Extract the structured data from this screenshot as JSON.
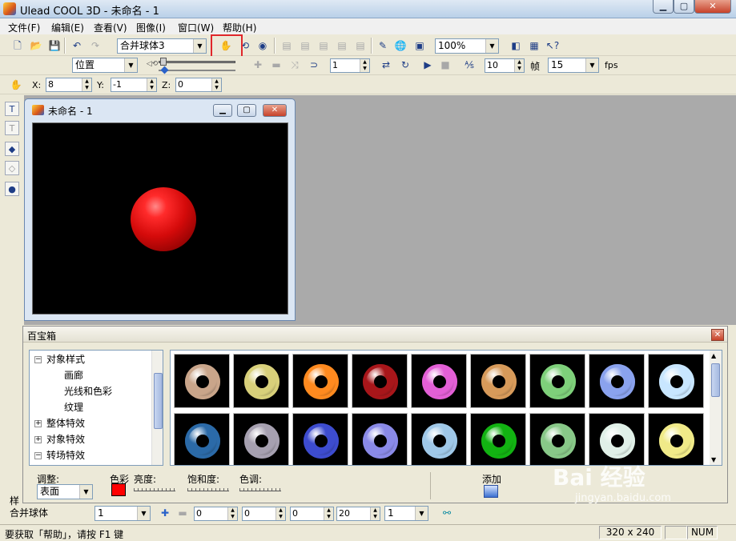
{
  "window": {
    "title": "Ulead COOL 3D - 未命名 - 1"
  },
  "menu": [
    "文件(F)",
    "编辑(E)",
    "查看(V)",
    "图像(I)",
    "窗口(W)",
    "帮助(H)"
  ],
  "toolbar1": {
    "object_combo": "合并球体3",
    "zoom_combo": "100%"
  },
  "toolbar2": {
    "mode_combo": "位置",
    "frame_value": "1",
    "frames_value": "10",
    "frames_label": "帧",
    "fps_value": "15",
    "fps_label": "fps"
  },
  "toolbar3": {
    "x_label": "X:",
    "x_value": "8",
    "y_label": "Y:",
    "y_value": "-1",
    "z_label": "Z:",
    "z_value": "0"
  },
  "document": {
    "title": "未命名 - 1"
  },
  "library": {
    "title": "百宝箱",
    "tree": [
      {
        "label": "对象样式",
        "expander": "−",
        "level": 0
      },
      {
        "label": "画廊",
        "level": 1
      },
      {
        "label": "光线和色彩",
        "level": 1
      },
      {
        "label": "纹理",
        "level": 1
      },
      {
        "label": "整体特效",
        "expander": "+",
        "level": 0
      },
      {
        "label": "对象特效",
        "expander": "+",
        "level": 0
      },
      {
        "label": "转场特效",
        "expander": "−",
        "level": 0
      }
    ],
    "adjust_label": "调整:",
    "adjust_value": "表面",
    "color_label": "色彩",
    "brightness_label": "亮度:",
    "saturation_label": "饱和度:",
    "hue_label": "色调:",
    "add_label": "添加",
    "thumbnail_colors": [
      "#c9a58a",
      "#d8d07a",
      "#ff8a1f",
      "#a8161a",
      "#e35fd6",
      "#d79a5a",
      "#7ed07a",
      "#8aa2ee",
      "#c8e6ff",
      "#2b6aa8",
      "#a6a0b0",
      "#3d4ccf",
      "#8a8ae8",
      "#9fc8e8",
      "#12b312",
      "#88c888",
      "#e0f0e8",
      "#f0ea88"
    ]
  },
  "bottombar": {
    "tab_label": "样",
    "object_name": "合并球体",
    "combo1": "1",
    "spin1": "0",
    "spin2": "0",
    "spin3": "0",
    "spin4": "20",
    "combo2": "1"
  },
  "statusbar": {
    "help_text": "要获取「帮助」，请按 F1 键",
    "size_text": "320 x 240",
    "num_text": "NUM"
  },
  "watermark": {
    "brand": "Bai 经验",
    "url": "jingyan.baidu.com"
  }
}
